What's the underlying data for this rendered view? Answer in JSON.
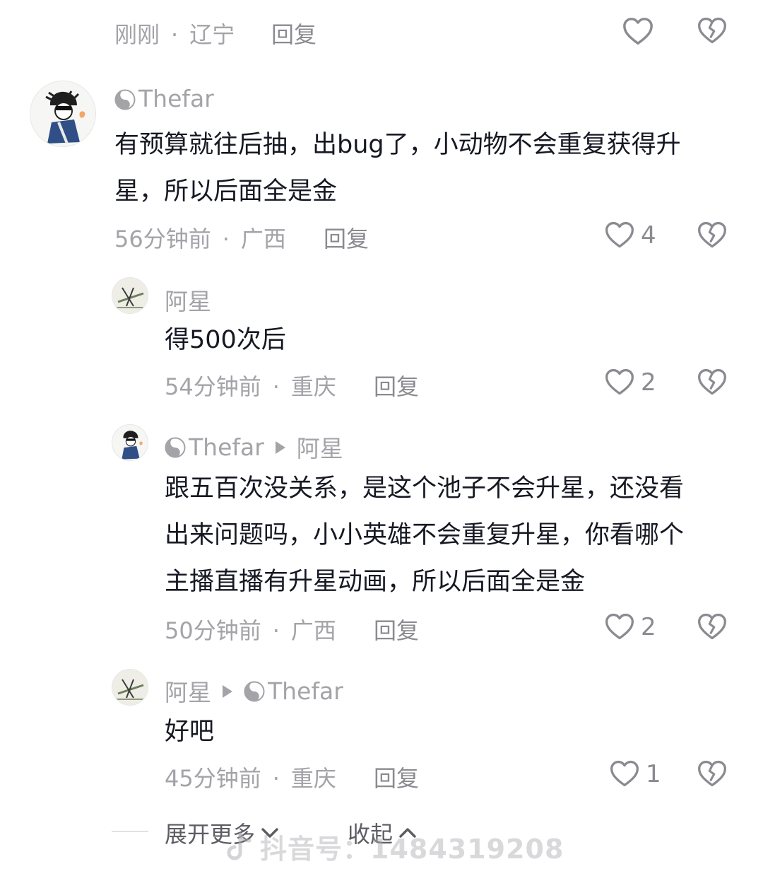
{
  "top_row": {
    "time": "刚刚",
    "location": "辽宁",
    "reply": "回复"
  },
  "comment": {
    "username": "Thefar",
    "text_line1": "有预算就往后抽，出bug了，小动物不会重复获得升",
    "text_line2": "星，所以后面全是金",
    "time": "56分钟前",
    "location": "广西",
    "reply": "回复",
    "likes": "4"
  },
  "replies": [
    {
      "username": "阿星",
      "reply_to": "",
      "lines": [
        "得500次后"
      ],
      "time": "54分钟前",
      "location": "重庆",
      "reply": "回复",
      "likes": "2"
    },
    {
      "username": "Thefar",
      "reply_to": "阿星",
      "lines": [
        "跟五百次没关系，是这个池子不会升星，还没看",
        "出来问题吗，小小英雄不会重复升星，你看哪个",
        "主播直播有升星动画，所以后面全是金"
      ],
      "time": "50分钟前",
      "location": "广西",
      "reply": "回复",
      "likes": "2"
    },
    {
      "username": "阿星",
      "reply_to": "Thefar",
      "lines": [
        "好吧"
      ],
      "time": "45分钟前",
      "location": "重庆",
      "reply": "回复",
      "likes": "1"
    }
  ],
  "footer": {
    "expand_more": "展开更多",
    "collapse": "收起"
  },
  "watermark": "抖音号：1484319208",
  "colors": {
    "text": "#161823",
    "meta": "#a3a3a8",
    "reply": "#8a8a90",
    "icon": "#8a8a90"
  }
}
